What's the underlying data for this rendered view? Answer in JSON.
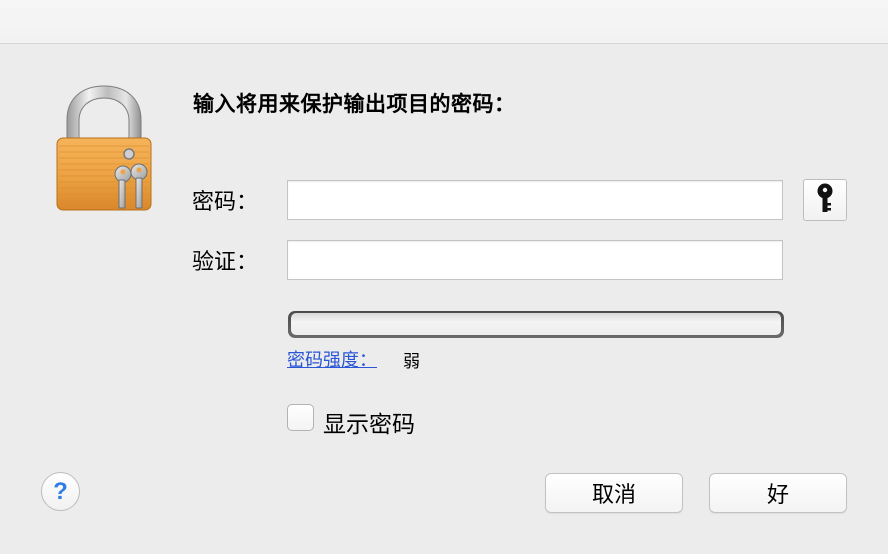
{
  "dialog": {
    "prompt": "输入将用来保护输出项目的密码：",
    "icon": "padlock-with-keys-icon"
  },
  "fields": {
    "password_label": "密码：",
    "password_value": "",
    "verify_label": "验证：",
    "verify_value": "",
    "key_button_icon": "key-icon"
  },
  "strength": {
    "link_label": "密码强度：",
    "value": "弱",
    "level": 0
  },
  "options": {
    "show_password_label": "显示密码",
    "show_password_checked": false
  },
  "buttons": {
    "help_label": "?",
    "cancel_label": "取消",
    "ok_label": "好"
  }
}
